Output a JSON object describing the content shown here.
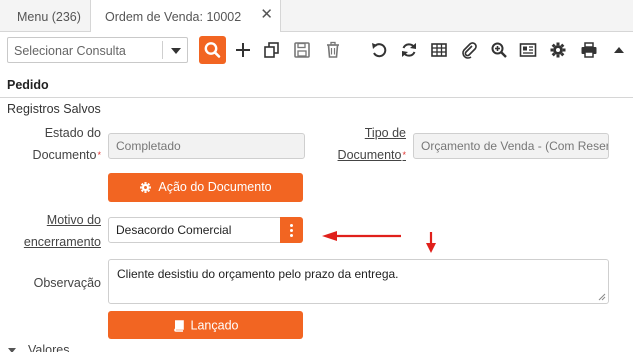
{
  "tabs": {
    "menu_label": "Menu (236)",
    "active_label": "Ordem de Venda: 10002",
    "close_glyph": "✕"
  },
  "toolbar": {
    "consulta_placeholder": "Selecionar Consulta",
    "icons": [
      "search-icon",
      "add-icon",
      "copy-icon",
      "save-icon",
      "delete-icon",
      "undo-icon",
      "refresh-icon",
      "grid-icon",
      "attachment-icon",
      "zoom-icon",
      "report-icon",
      "settings-icon",
      "print-icon",
      "collapse-icon"
    ]
  },
  "section": {
    "title": "Pedido",
    "subtitle": "Registros Salvos"
  },
  "form": {
    "estado_label_1": "Estado do",
    "estado_label_2": "Documento",
    "estado_value": "Completado",
    "tipo_label_1": "Tipo de",
    "tipo_label_2": "Documento",
    "tipo_value": "Orçamento de Venda - (Com Reserva)",
    "acao_button": "Ação do Documento",
    "motivo_label_1": "Motivo do",
    "motivo_label_2": "encerramento",
    "motivo_value": "Desacordo Comercial",
    "observacao_label": "Observação",
    "observacao_value": "Cliente desistiu do orçamento pelo prazo da entrega.",
    "lancado_button": "Lançado",
    "required_mark": "*"
  },
  "footer": {
    "valores_label": "Valores"
  },
  "colors": {
    "accent": "#f26522",
    "annotation": "#e0201b"
  }
}
